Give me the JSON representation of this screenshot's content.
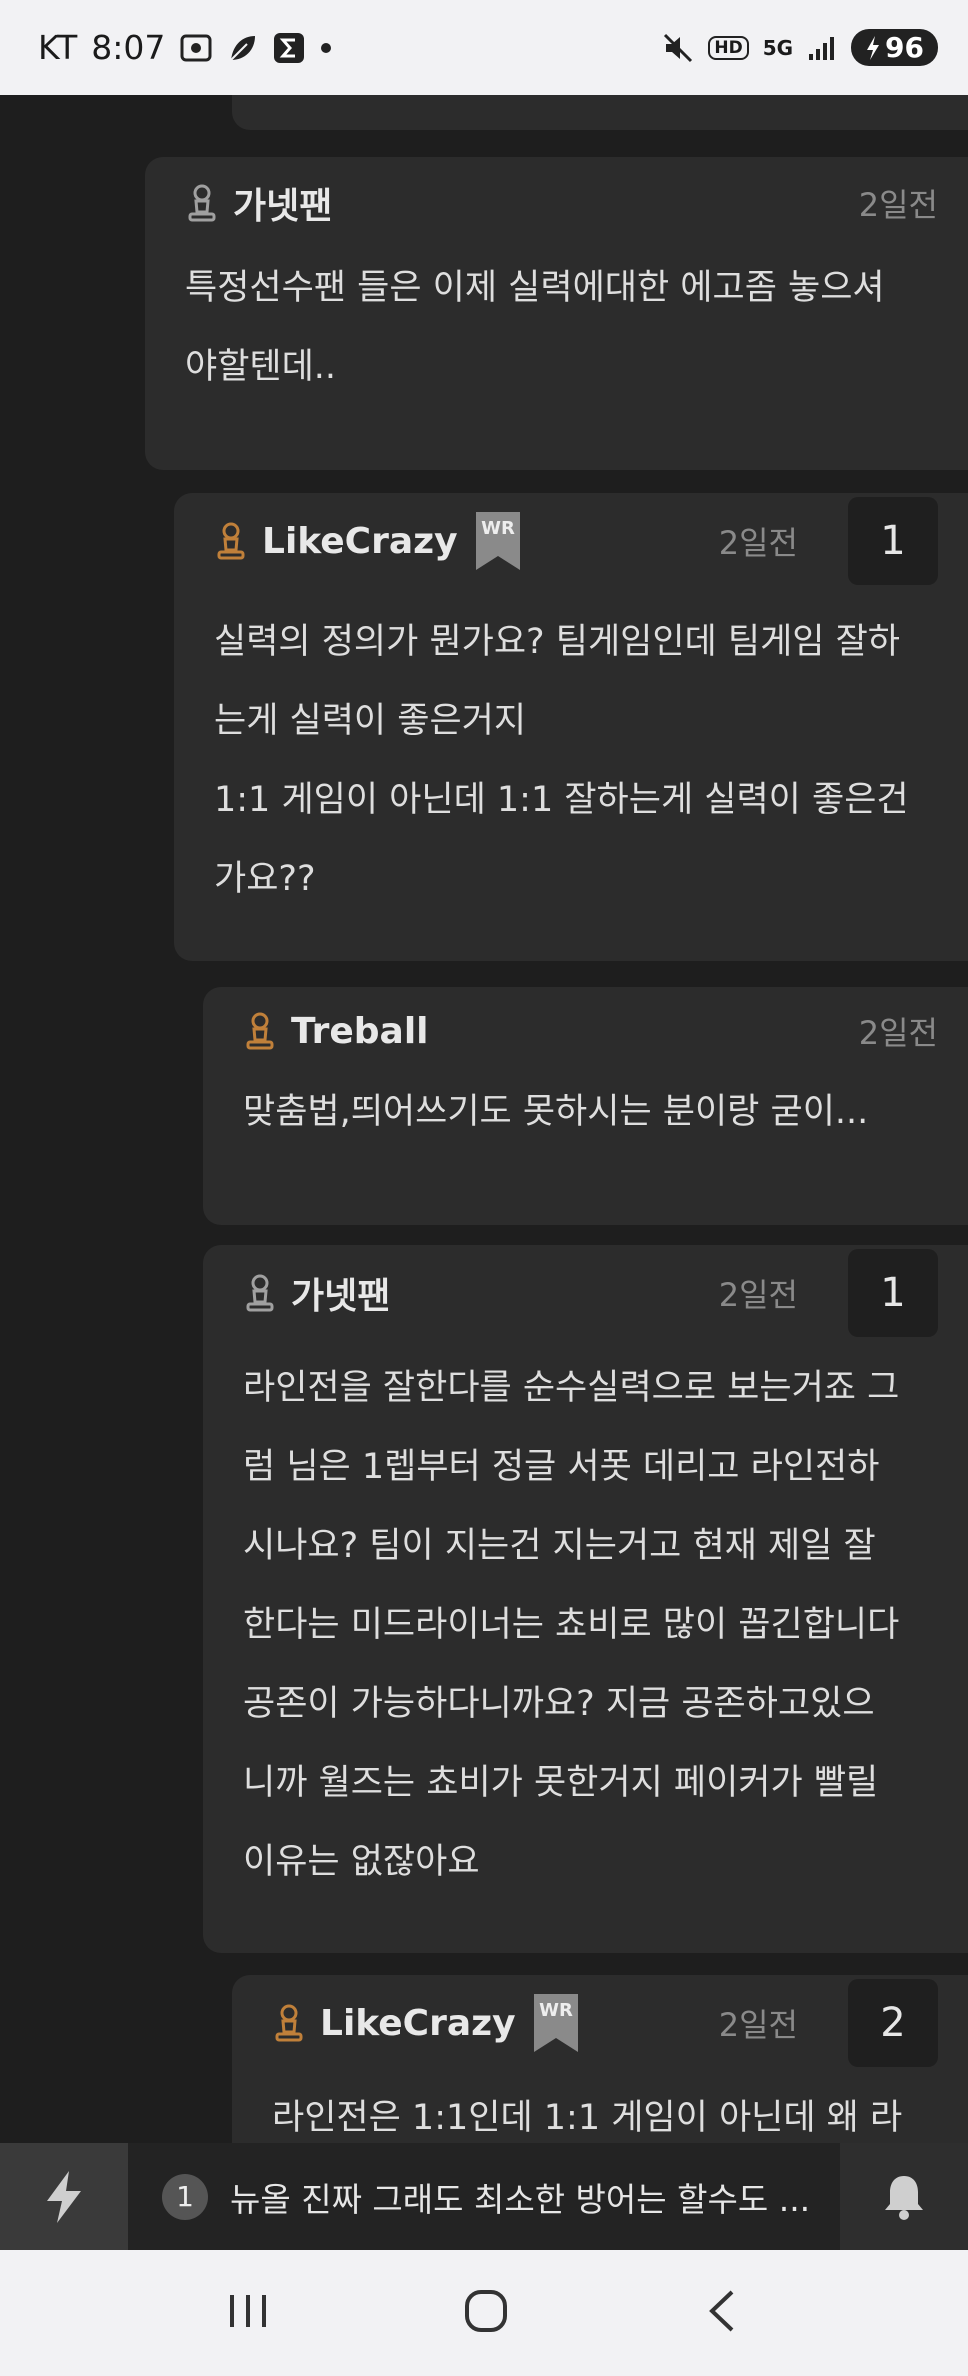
{
  "status_bar": {
    "carrier": "KT",
    "time": "8:07",
    "network_hd": "HD",
    "network_5g": "5G",
    "battery": "96"
  },
  "comments": [
    {
      "author": "가넷팬",
      "time": "2일전",
      "body": "특정선수팬 들은 이제 실력에대한 에고좀 놓으셔\n야할텐데..",
      "count": ""
    },
    {
      "author": "LikeCrazy",
      "badge": "WR",
      "time": "2일전",
      "count": "1",
      "body": "실력의 정의가 뭔가요? 팀게임인데 팀게임 잘하\n는게 실력이 좋은거지\n1:1 게임이 아닌데 1:1 잘하는게 실력이 좋은건\n가요??"
    },
    {
      "author": "Treball",
      "time": "2일전",
      "count": "",
      "body": "맞춤법,띄어쓰기도 못하시는 분이랑 굳이..."
    },
    {
      "author": "가넷팬",
      "time": "2일전",
      "count": "1",
      "body": "라인전을 잘한다를 순수실력으로 보는거죠 그\n럼 님은 1렙부터 정글 서폿 데리고 라인전하\n시나요? 팀이 지는건 지는거고 현재 제일 잘\n한다는 미드라이너는 쵸비로 많이 꼽긴합니다\n공존이 가능하다니까요? 지금 공존하고있으\n니까 월즈는 쵸비가 못한거지 페이커가 빨릴\n이유는 없잖아요"
    },
    {
      "author": "LikeCrazy",
      "badge": "WR",
      "time": "2일전",
      "count": "2",
      "body": "라인전은 1:1인데 1:1 게임이 아닌데 왜 라"
    }
  ],
  "bottom_bar": {
    "notice_number": "1",
    "notice_text": "뉴올 진짜 그래도 최소한 방어는 할수도 ..."
  },
  "icons": {
    "user": "user-pawn-icon",
    "bolt": "lightning-icon",
    "bell": "bell-icon",
    "wr": "wr-bookmark-badge"
  },
  "colors": {
    "background": "#1e1e1e",
    "card": "#2c2c2c",
    "gold_user": "#c0803a",
    "gray_user": "#a0a0a0",
    "badge": "#8a8a8a"
  }
}
